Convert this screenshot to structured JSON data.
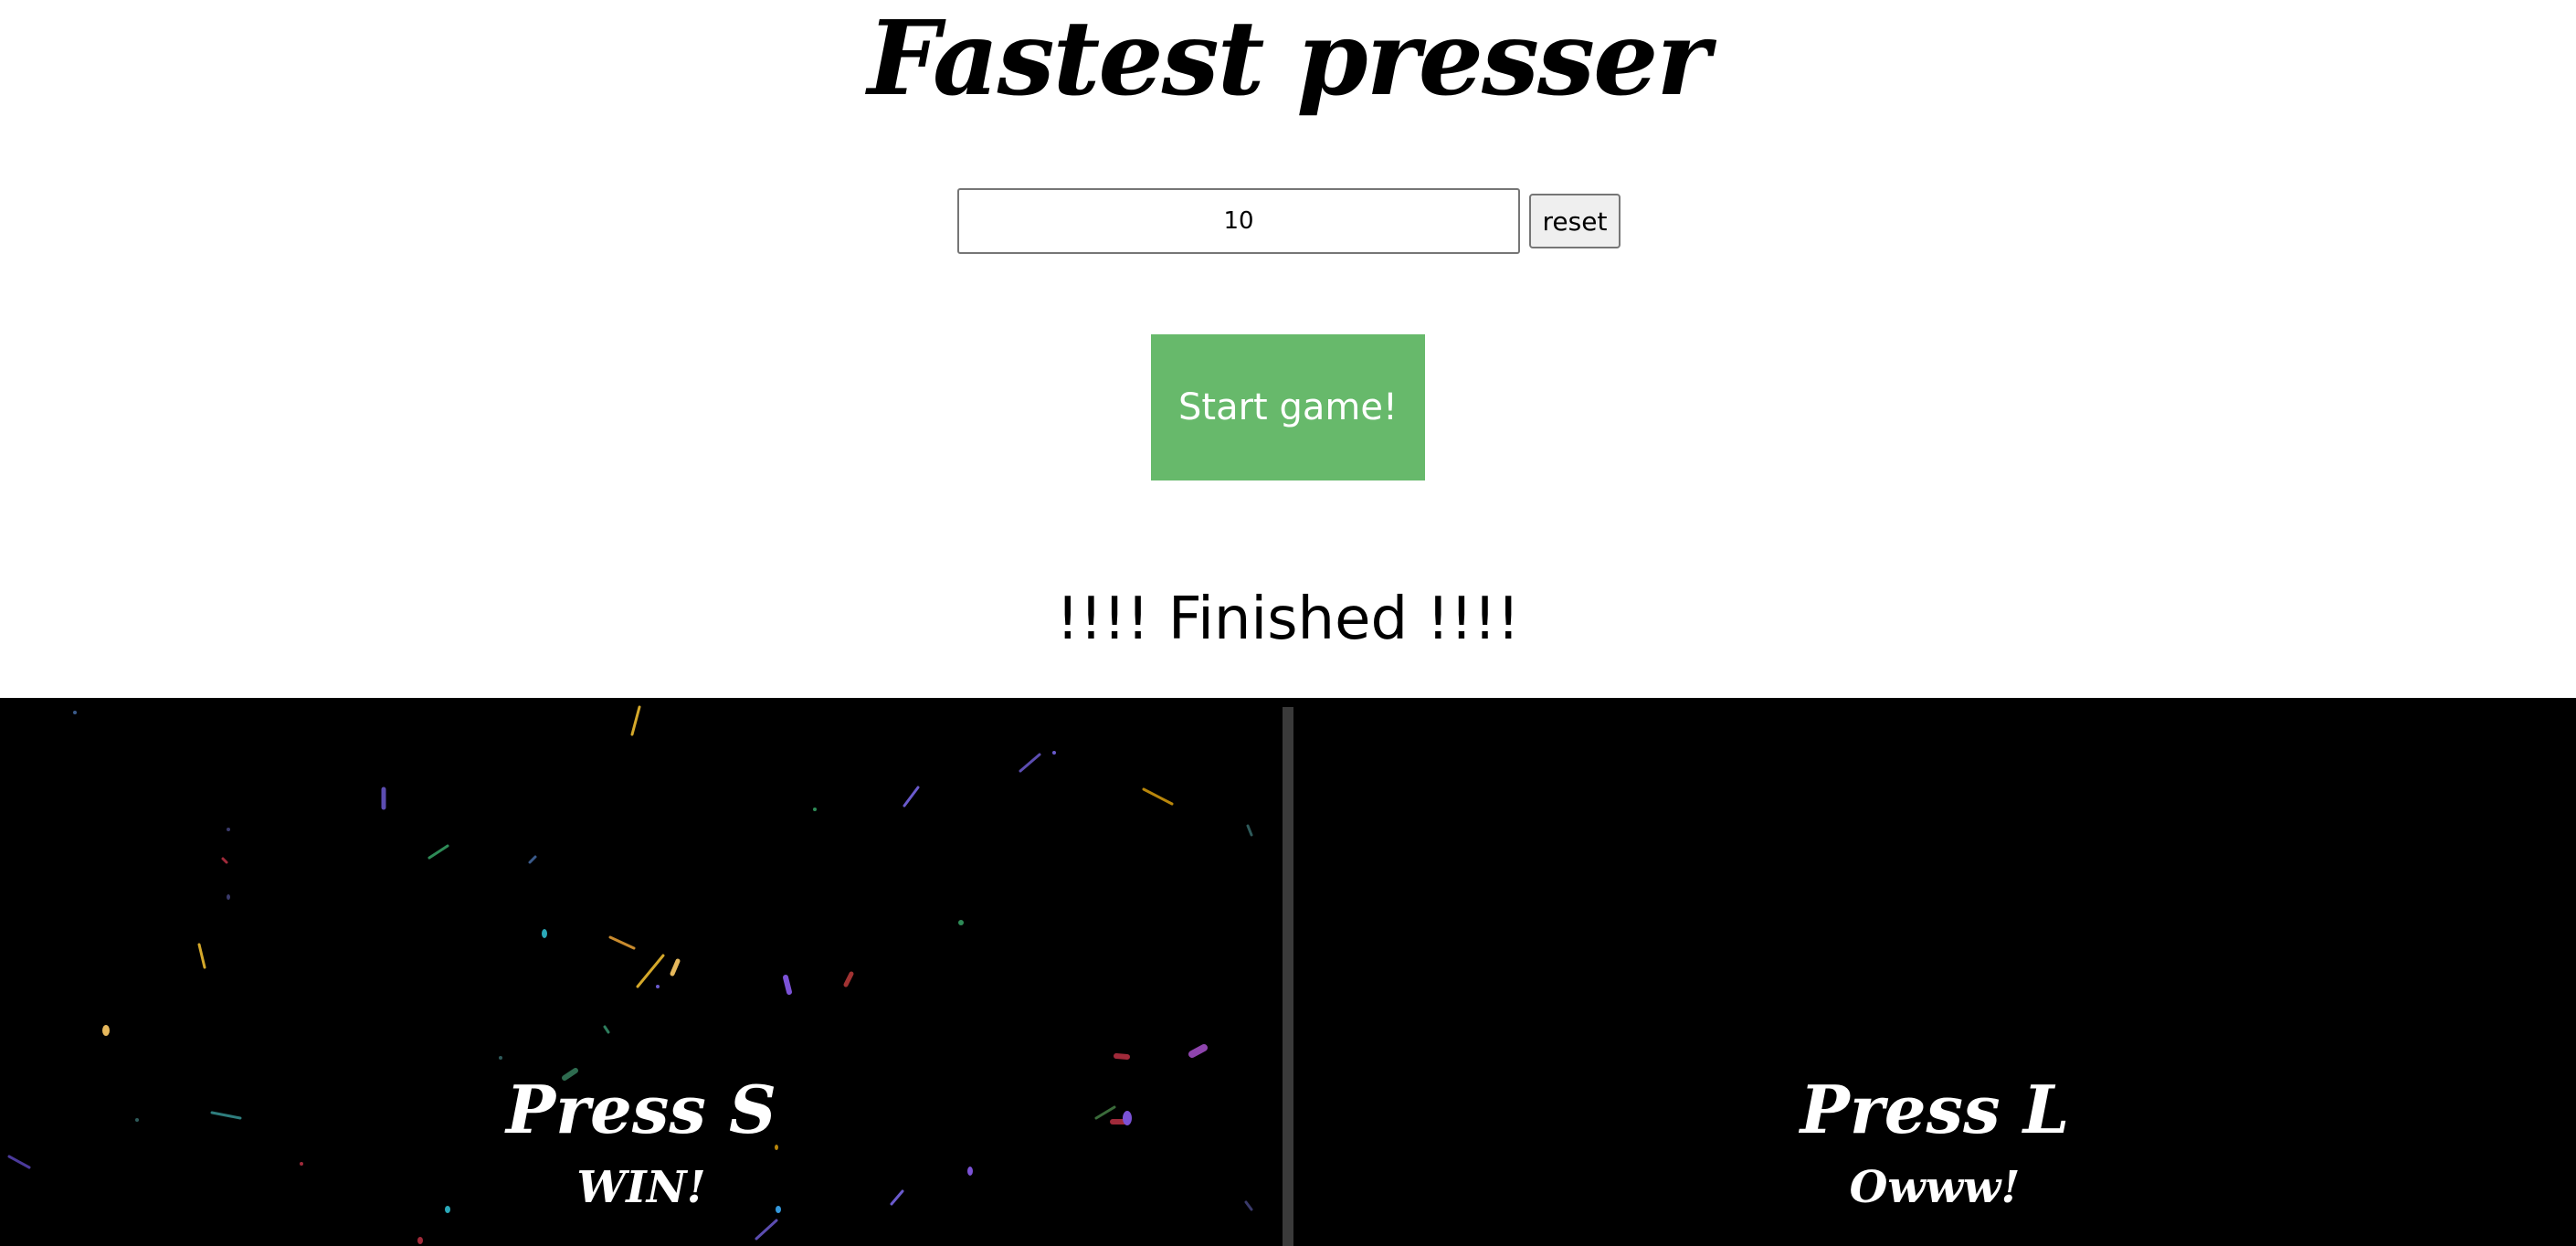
{
  "header": {
    "title": "Fastest presser"
  },
  "controls": {
    "presses_value": "10",
    "reset_label": "reset"
  },
  "start_button": {
    "label": "Start game!",
    "color": "#67b96b"
  },
  "status": {
    "text": "!!!! Finished !!!!"
  },
  "players": [
    {
      "key_prompt": "Press S",
      "result": "WIN!"
    },
    {
      "key_prompt": "Press L",
      "result": "Owww!"
    }
  ],
  "arena": {
    "background": "#000000",
    "divider_color": "#3a3a3a",
    "confetti_colors": [
      "#f2c14e",
      "#6a5acd",
      "#2e8b57",
      "#c0392b",
      "#8e44ad",
      "#1abc9c",
      "#e67e22",
      "#3498db",
      "#9b59b6",
      "#d35400"
    ]
  }
}
